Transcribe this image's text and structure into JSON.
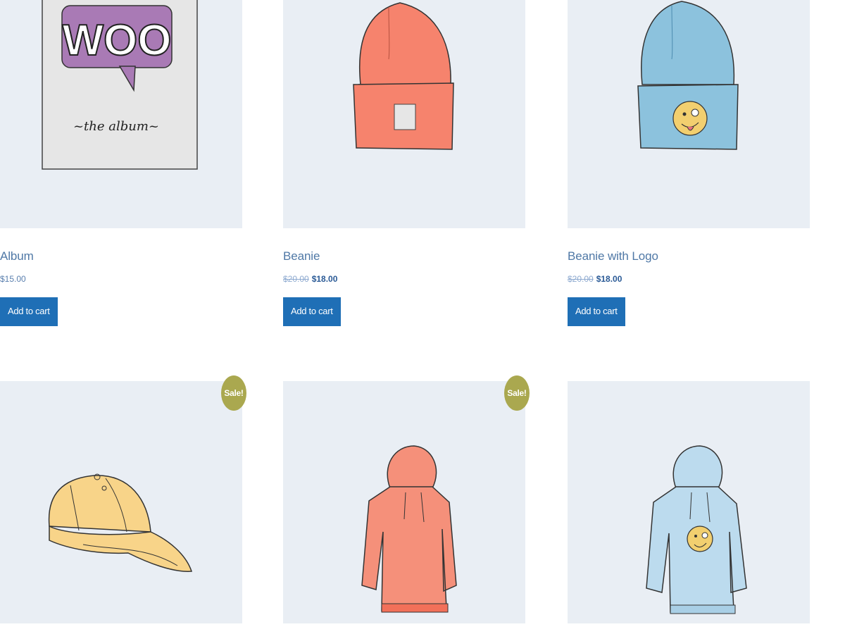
{
  "products": [
    {
      "title": "Album",
      "price": "$15.00",
      "old_price": "",
      "sale_price": "",
      "button": "Add to cart",
      "image": "album-illustration",
      "image_text": {
        "logo": "WOO",
        "caption": "~the album~"
      }
    },
    {
      "title": "Beanie",
      "price": "",
      "old_price": "$20.00",
      "sale_price": "$18.00",
      "button": "Add to cart",
      "image": "beanie-illustration",
      "colors": {
        "main": "#f6836d"
      }
    },
    {
      "title": "Beanie with Logo",
      "price": "",
      "old_price": "$20.00",
      "sale_price": "$18.00",
      "button": "Add to cart",
      "image": "beanie-with-logo-illustration",
      "colors": {
        "main": "#8cc2dd"
      }
    },
    {
      "sale_badge": "Sale!",
      "image": "cap-illustration",
      "colors": {
        "main": "#f8d489"
      }
    },
    {
      "sale_badge": "Sale!",
      "image": "hoodie-illustration",
      "colors": {
        "main": "#f5907a"
      }
    },
    {
      "image": "hoodie-with-logo-illustration",
      "colors": {
        "main": "#bcdbee"
      }
    }
  ],
  "colors": {
    "thumb_bg": "#e9eef4",
    "button_bg": "#1f6fb6",
    "title": "#4f78a6",
    "sale_badge": "#aaa84f"
  }
}
